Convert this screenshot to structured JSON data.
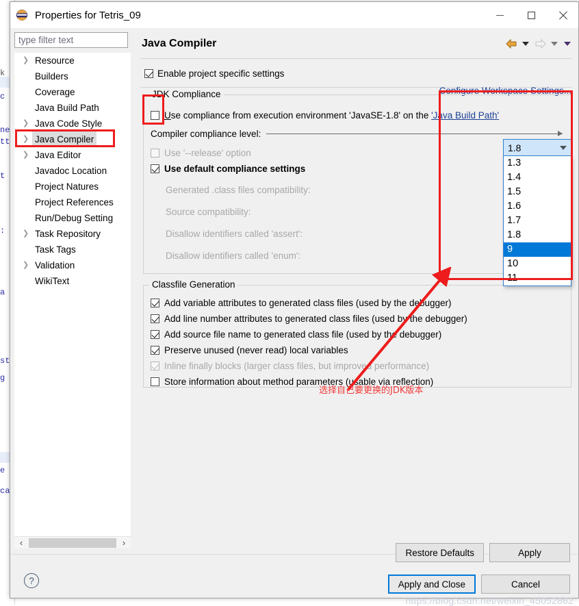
{
  "window": {
    "title": "Properties for Tetris_09",
    "app_icon": "eclipse-icon",
    "minimize_label": "Minimize",
    "maximize_label": "Maximize",
    "close_label": "Close"
  },
  "sidebar": {
    "filter_placeholder": "type filter text",
    "filter_value": "",
    "items": [
      {
        "label": "Resource",
        "expandable": true,
        "selected": false
      },
      {
        "label": "Builders",
        "expandable": false,
        "selected": false
      },
      {
        "label": "Coverage",
        "expandable": false,
        "selected": false
      },
      {
        "label": "Java Build Path",
        "expandable": false,
        "selected": false
      },
      {
        "label": "Java Code Style",
        "expandable": true,
        "selected": false
      },
      {
        "label": "Java Compiler",
        "expandable": true,
        "selected": true
      },
      {
        "label": "Java Editor",
        "expandable": true,
        "selected": false
      },
      {
        "label": "Javadoc Location",
        "expandable": false,
        "selected": false
      },
      {
        "label": "Project Natures",
        "expandable": false,
        "selected": false
      },
      {
        "label": "Project References",
        "expandable": false,
        "selected": false
      },
      {
        "label": "Run/Debug Setting",
        "expandable": false,
        "selected": false
      },
      {
        "label": "Task Repository",
        "expandable": true,
        "selected": false
      },
      {
        "label": "Task Tags",
        "expandable": false,
        "selected": false
      },
      {
        "label": "Validation",
        "expandable": true,
        "selected": false
      },
      {
        "label": "WikiText",
        "expandable": false,
        "selected": false
      }
    ],
    "scroll_left_icon": "‹",
    "scroll_right_icon": "›"
  },
  "page": {
    "title": "Java Compiler",
    "enable_project_specific": "Enable project specific settings",
    "enable_checked": true,
    "configure_workspace_link": "Configure Workspace Settings...",
    "nav": {
      "back_icon": "arrow-left-icon",
      "back_menu_icon": "chevron-down-icon",
      "forward_icon": "arrow-right-icon",
      "forward_menu_icon": "chevron-down-icon",
      "extra_menu_icon": "chevron-down-icon"
    }
  },
  "jdk_compliance": {
    "legend": "JDK Compliance",
    "use_execution_env": {
      "prefix": "U",
      "label": "se compliance from execution environment 'JavaSE-1.8' on the ",
      "link": "'Java Build Path'",
      "checked": false
    },
    "compliance_level_label": "Compiler compliance level:",
    "compliance_level_value": "1.8",
    "compliance_options": [
      "1.3",
      "1.4",
      "1.5",
      "1.6",
      "1.7",
      "1.8",
      "9",
      "10",
      "11"
    ],
    "compliance_highlighted": "9",
    "use_release_option": {
      "label": "Use '--release' option",
      "checked": false,
      "disabled": true
    },
    "use_default_settings": {
      "label": "Use default compliance settings",
      "checked": true,
      "disabled": false
    },
    "disabled_rows": [
      "Generated .class files compatibility:",
      "Source compatibility:",
      "Disallow identifiers called 'assert':",
      "Disallow identifiers called 'enum':"
    ]
  },
  "classfile_generation": {
    "legend": "Classfile Generation",
    "options": [
      {
        "label": "Add variable attributes to generated class files (used by the debugger)",
        "checked": true,
        "disabled": false
      },
      {
        "label": "Add line number attributes to generated class files (used by the debugger)",
        "checked": true,
        "disabled": false
      },
      {
        "label": "Add source file name to generated class file (used by the debugger)",
        "checked": true,
        "disabled": false
      },
      {
        "label": "Preserve unused (never read) local variables",
        "checked": true,
        "disabled": false
      },
      {
        "label": "Inline finally blocks (larger class files, but improved performance)",
        "checked": true,
        "disabled": true
      },
      {
        "label": "Store information about method parameters (usable via reflection)",
        "checked": false,
        "disabled": false
      }
    ]
  },
  "buttons": {
    "restore_defaults": "Restore Defaults",
    "apply": "Apply",
    "apply_and_close": "Apply and Close",
    "cancel": "Cancel",
    "help_icon": "?"
  },
  "annotations": {
    "note_text": "选择自己要更换的JDK版本",
    "highlight_color": "#ee1c1c"
  },
  "watermark": "https://blog.csdn.net/weixin_45052862"
}
